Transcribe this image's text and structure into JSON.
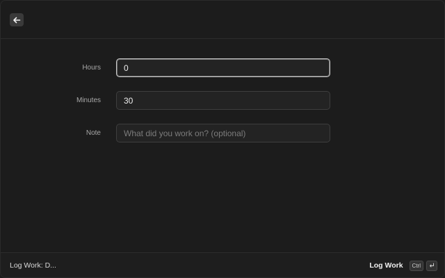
{
  "header": {
    "back_icon": "arrow-left-icon"
  },
  "form": {
    "hours": {
      "label": "Hours",
      "value": "0"
    },
    "minutes": {
      "label": "Minutes",
      "value": "30"
    },
    "note": {
      "label": "Note",
      "value": "",
      "placeholder": "What did you work on? (optional)"
    }
  },
  "footer": {
    "title": "Log Work: D...",
    "action_label": "Log Work",
    "shortcut_key_1": "Ctrl",
    "shortcut_key_2_icon": "enter-icon"
  }
}
